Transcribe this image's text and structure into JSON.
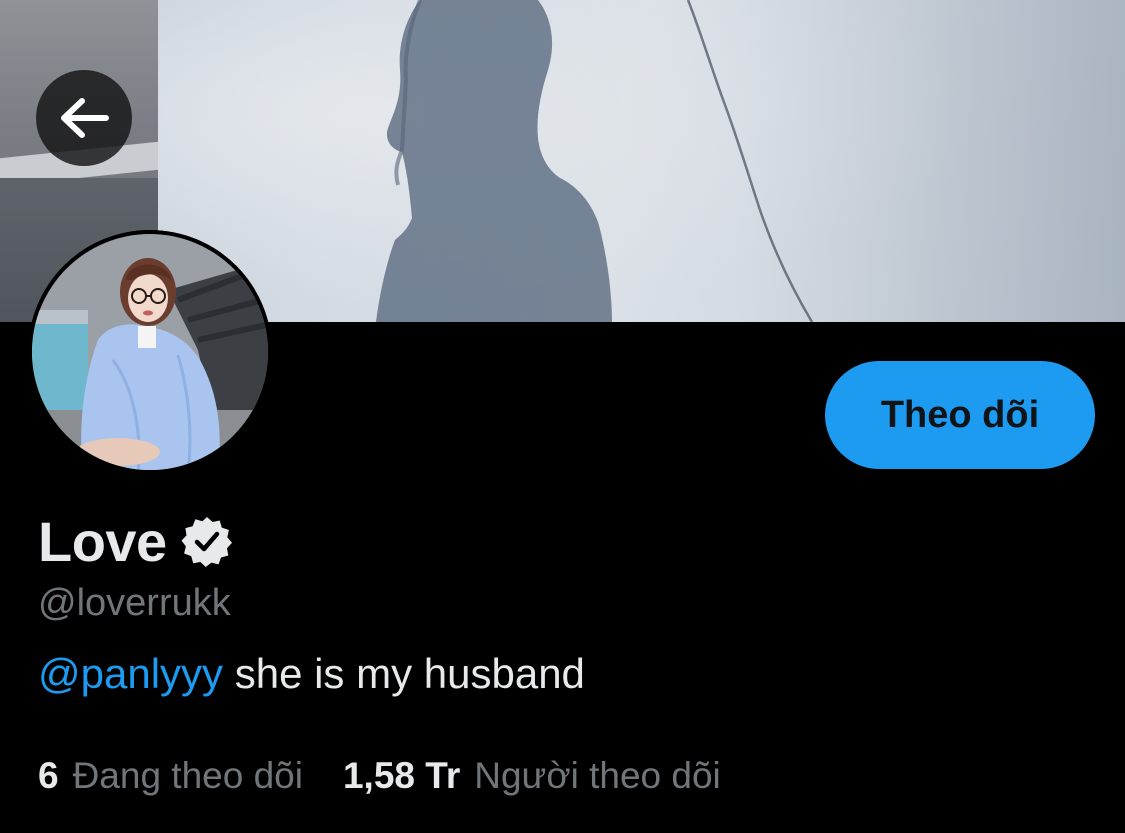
{
  "profile": {
    "display_name": "Love",
    "handle": "@loverrukk",
    "verified": true,
    "bio": {
      "mention": "@panlyyy",
      "text": " she is my husband"
    },
    "stats": [
      {
        "value": "6",
        "label": "Đang theo dõi"
      },
      {
        "value": "1,58 Tr",
        "label": "Người theo dõi"
      }
    ]
  },
  "actions": {
    "follow_label": "Theo dõi",
    "back_icon": "arrow-left-icon"
  },
  "colors": {
    "background": "#000000",
    "accent": "#1d9bf0",
    "primary_text": "#e7e9ea",
    "secondary_text": "#71767b"
  }
}
